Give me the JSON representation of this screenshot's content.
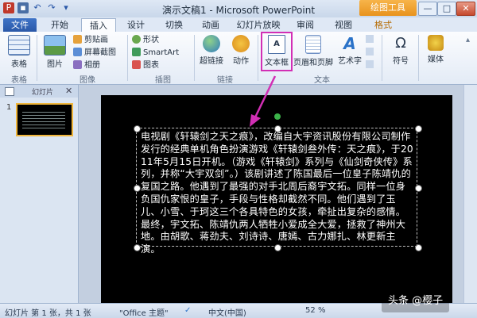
{
  "window": {
    "title": "演示文稿1 - Microsoft PowerPoint",
    "context_tools": "绘图工具",
    "buttons": {
      "minimize": "—",
      "maximize": "□",
      "close": "✕"
    }
  },
  "tabs": [
    {
      "label": "文件"
    },
    {
      "label": "开始"
    },
    {
      "label": "插入"
    },
    {
      "label": "设计"
    },
    {
      "label": "切换"
    },
    {
      "label": "动画"
    },
    {
      "label": "幻灯片放映"
    },
    {
      "label": "审阅"
    },
    {
      "label": "视图"
    },
    {
      "label": "格式"
    }
  ],
  "ribbon": {
    "groups": {
      "tables": "表格",
      "images": "图像",
      "illustrations": "插图",
      "links": "链接",
      "text": "文本"
    },
    "buttons": {
      "table": "表格",
      "picture": "图片",
      "clipart": "剪贴画",
      "screenshot": "屏幕截图",
      "album": "相册",
      "shapes": "形状",
      "smartart": "SmartArt",
      "chart": "图表",
      "hyperlink": "超链接",
      "action": "动作",
      "textbox": "文本框",
      "header_footer": "页眉和页脚",
      "wordart": "艺术字",
      "symbol": "符号",
      "media": "媒体"
    }
  },
  "left_pane": {
    "tab_slides": "幻灯片",
    "slide_number": "1"
  },
  "slide": {
    "text": "电视剧《轩辕剑之天之痕》，改编自大宇资讯股份有限公司制作发行的经典单机角色扮演游戏《轩辕剑叁外传：天之痕》，于2011年5月15日开机。（游戏《轩辕剑》系列与《仙剑奇侠传》系列，并称“大宇双剑”。）该剧讲述了陈国最后一位皇子陈靖仇的复国之路。他遇到了最强的对手北周后裔宇文拓。同样一位身负国仇家恨的皇子，手段与性格却截然不同。他们遇到了玉儿、小雪、于珂这三个各具特色的女孩，牵扯出复杂的感情。最终，宇文拓、陈靖仇两人牺牲小爱成全大爱，拯救了神州大地。由胡歌、蒋劲夫、刘诗诗、唐嫣、古力娜扎、林更新主演。"
  },
  "status": {
    "slide_info": "幻灯片 第 1 张，共 1 张",
    "theme": "\"Office 主题\"",
    "language": "中文(中国)",
    "zoom": "52"
  },
  "watermark": "头条 @樱子",
  "colors": {
    "highlight": "#d22fb5",
    "arrow": "#d22fb5",
    "file_tab": "#2a58a8",
    "context_tools": "#e8931d"
  }
}
